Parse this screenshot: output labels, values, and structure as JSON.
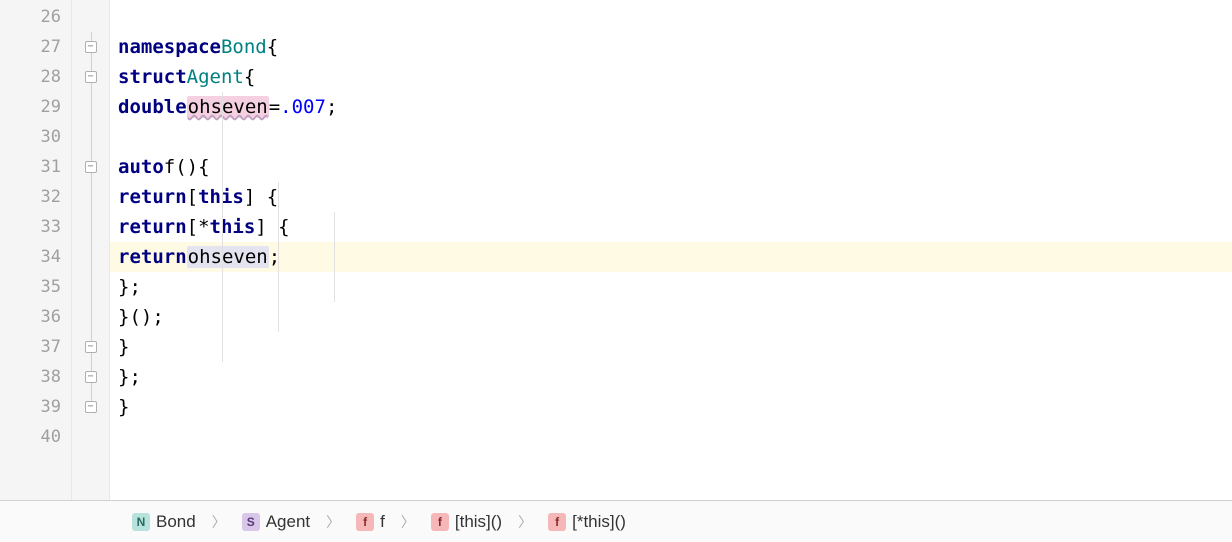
{
  "gutter": {
    "lines": [
      "26",
      "27",
      "28",
      "29",
      "30",
      "31",
      "32",
      "33",
      "34",
      "35",
      "36",
      "37",
      "38",
      "39",
      "40"
    ]
  },
  "code": {
    "l27": {
      "kw1": "namespace",
      "name": "Bond",
      "brace": "{"
    },
    "l28": {
      "kw1": "struct",
      "name": "Agent",
      "brace": "{"
    },
    "l29": {
      "kw1": "double",
      "field": "ohseven",
      "eq": "=",
      "val": ".007",
      "semi": ";"
    },
    "l31": {
      "kw1": "auto",
      "fn": "f",
      "parens": "()",
      "brace": "{"
    },
    "l32": {
      "kw1": "return",
      "cap": "[",
      "kw2": "this",
      "close": "] {"
    },
    "l33": {
      "kw1": "return",
      "cap": "[*",
      "kw2": "this",
      "close": "] {"
    },
    "l34": {
      "kw1": "return",
      "ref": "ohseven",
      "semi": ";"
    },
    "l35": {
      "close": "};"
    },
    "l36": {
      "close": "}();"
    },
    "l37": {
      "close": "}"
    },
    "l38": {
      "close": "};"
    },
    "l39": {
      "close": "}"
    }
  },
  "fold": {
    "markers": [
      27,
      28,
      31,
      37,
      38,
      39
    ]
  },
  "breadcrumb": {
    "items": [
      {
        "icon": "N",
        "iconClass": "namespace",
        "label": "Bond"
      },
      {
        "icon": "S",
        "iconClass": "struct",
        "label": "Agent"
      },
      {
        "icon": "f",
        "iconClass": "function",
        "label": "f"
      },
      {
        "icon": "f",
        "iconClass": "function",
        "label": "[this]()"
      },
      {
        "icon": "f",
        "iconClass": "function",
        "label": "[*this]()"
      }
    ]
  }
}
